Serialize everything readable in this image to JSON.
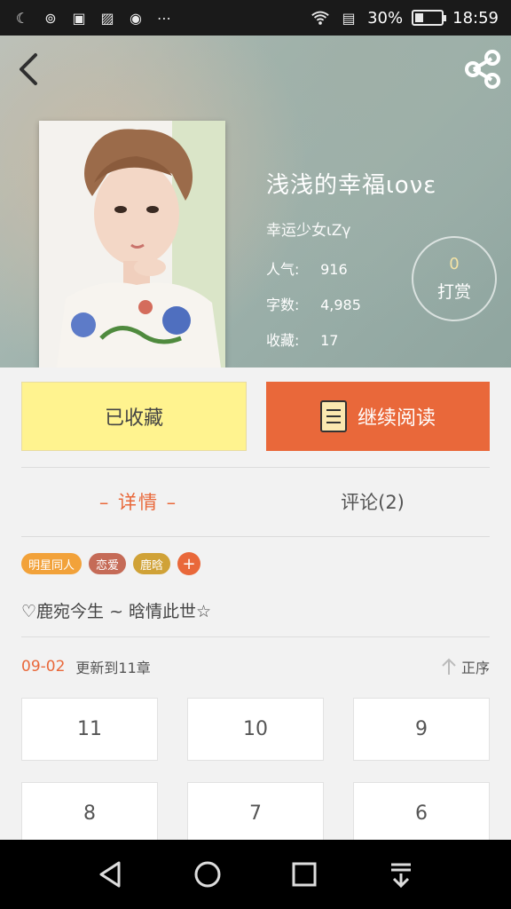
{
  "status_bar": {
    "battery": "30%",
    "battery_level": 0.3,
    "time": "18:59"
  },
  "book": {
    "title": "浅浅的幸福ιονε",
    "author": "幸运少女ιΖγ",
    "popularity_label": "人气:",
    "popularity_value": "916",
    "words_label": "字数:",
    "words_value": "4,985",
    "favorites_label": "收藏:",
    "favorites_value": "17"
  },
  "tip": {
    "count": "0",
    "label": "打赏"
  },
  "actions": {
    "collected_label": "已收藏",
    "continue_label": "继续阅读"
  },
  "tabs": {
    "details": "– 详情 –",
    "comments": "评论(2)"
  },
  "tags": [
    {
      "label": "明星同人",
      "color": "#f2a23a"
    },
    {
      "label": "恋爱",
      "color": "#c56b57"
    },
    {
      "label": "鹿晗",
      "color": "#d0a237"
    }
  ],
  "tag_add": "+",
  "intro": "♡鹿宛今生 ~ 晗情此世☆",
  "update": {
    "date": "09-02",
    "text": "更新到11章",
    "sort_label": "正序"
  },
  "chapters": [
    "11",
    "10",
    "9",
    "8",
    "7",
    "6"
  ],
  "colors": {
    "accent": "#e9683a",
    "collected_bg": "#fff38f",
    "status_bar": "#1a1a1a",
    "nav_bar": "#000000"
  }
}
